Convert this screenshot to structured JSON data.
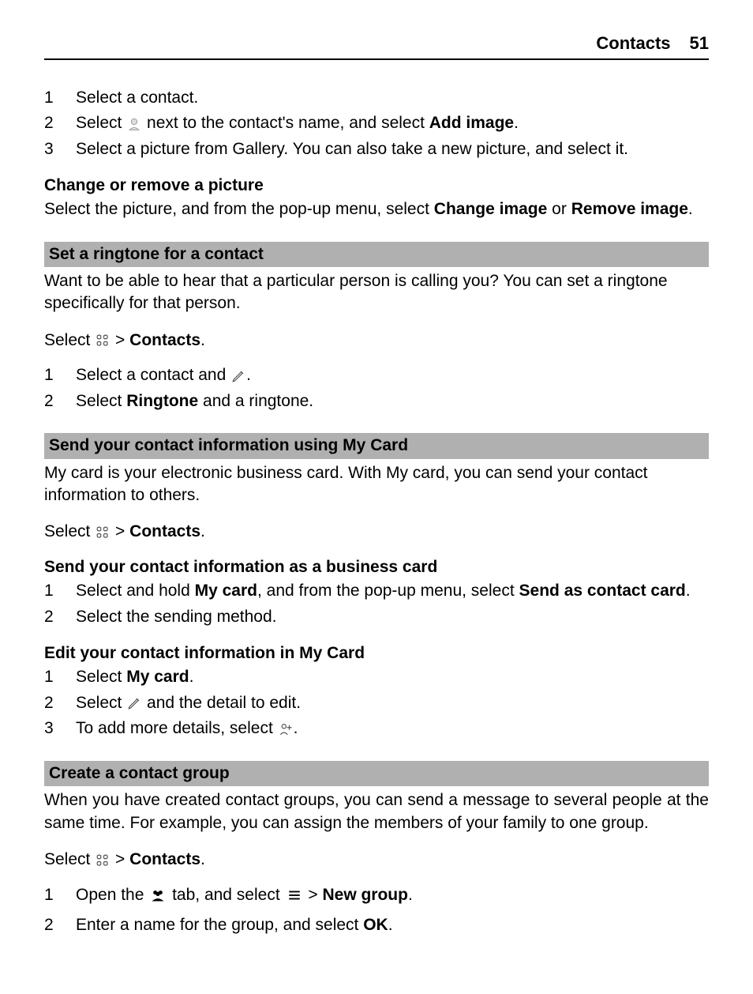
{
  "header": {
    "title": "Contacts",
    "page_number": "51"
  },
  "steps_top": [
    {
      "num": "1",
      "pre": "Select a contact."
    },
    {
      "num": "2",
      "pre": "Select ",
      "post": " next to the contact's name, and select ",
      "bold1": "Add image",
      "tail": "."
    },
    {
      "num": "3",
      "pre": "Select a picture from Gallery. You can also take a new picture, and select it."
    }
  ],
  "change_remove": {
    "heading": "Change or remove a picture",
    "text_a": "Select the picture, and from the pop-up menu, select ",
    "bold1": "Change image",
    "text_b": " or ",
    "bold2": "Remove image",
    "text_c": "."
  },
  "ringtone": {
    "heading": "Set a ringtone for a contact",
    "intro": "Want to be able to hear that a particular person is calling you? You can set a ringtone specifically for that person.",
    "select_pre": "Select ",
    "select_mid": " > ",
    "contacts": "Contacts",
    "select_post": ".",
    "steps": [
      {
        "num": "1",
        "pre": "Select a contact and ",
        "post": "."
      },
      {
        "num": "2",
        "pre": "Select ",
        "bold1": "Ringtone",
        "post": " and a ringtone."
      }
    ]
  },
  "mycard": {
    "heading": "Send your contact information using My Card",
    "intro": "My card is your electronic business card. With My card, you can send your contact information to others.",
    "select_pre": "Select ",
    "select_mid": " > ",
    "contacts": "Contacts",
    "select_post": "."
  },
  "send_biz": {
    "heading": "Send your contact information as a business card",
    "steps": [
      {
        "num": "1",
        "pre": "Select and hold ",
        "bold1": "My card",
        "mid": ", and from the pop-up menu, select ",
        "bold2": "Send as contact card",
        "post": "."
      },
      {
        "num": "2",
        "pre": "Select the sending method."
      }
    ]
  },
  "edit_card": {
    "heading": "Edit your contact information in My Card",
    "steps": [
      {
        "num": "1",
        "pre": "Select ",
        "bold1": "My card",
        "post": "."
      },
      {
        "num": "2",
        "pre": "Select ",
        "post": " and the detail to edit."
      },
      {
        "num": "3",
        "pre": "To add more details, select ",
        "post": "."
      }
    ]
  },
  "group": {
    "heading": "Create a contact group",
    "intro": "When you have created contact groups, you can send a message to several people at the same time. For example, you can assign the members of your family to one group.",
    "select_pre": "Select ",
    "select_mid": " > ",
    "contacts": "Contacts",
    "select_post": ".",
    "steps": [
      {
        "num": "1",
        "pre": "Open the ",
        "mid": " tab, and select ",
        "mid2": " > ",
        "bold1": "New group",
        "post": "."
      },
      {
        "num": "2",
        "pre": "Enter a name for the group, and select ",
        "bold1": "OK",
        "post": "."
      }
    ]
  }
}
